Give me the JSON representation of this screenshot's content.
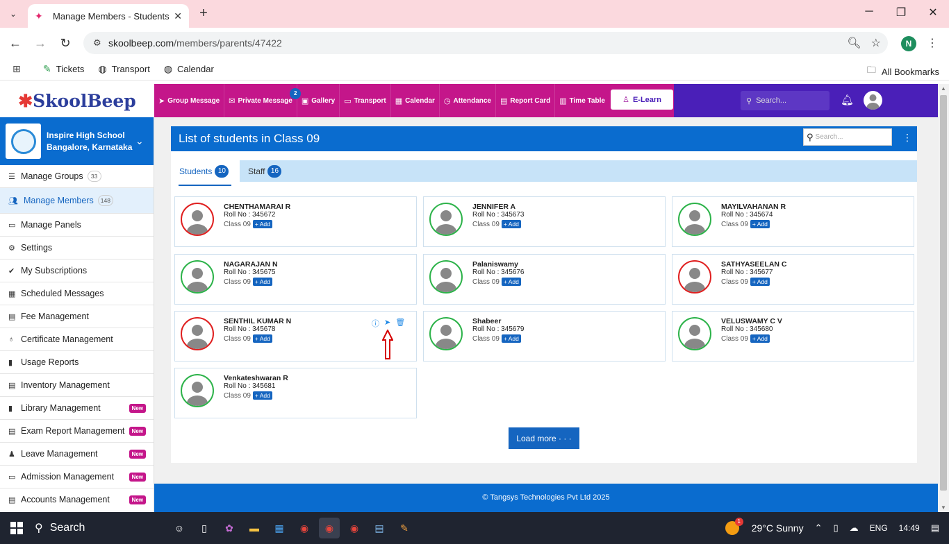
{
  "browser": {
    "tab_title": "Manage Members - Students",
    "url_domain": "skoolbeep.com",
    "url_path": "/members/parents/47422",
    "profile_initial": "N",
    "bookmarks": [
      "Tickets",
      "Transport",
      "Calendar"
    ],
    "all_bookmarks": "All Bookmarks"
  },
  "header": {
    "logo": "SkoolBeep",
    "menu": [
      {
        "label": "Group Message",
        "icon": "send-icon"
      },
      {
        "label": "Private Message",
        "icon": "mail-icon",
        "badge": "2"
      },
      {
        "label": "Gallery",
        "icon": "image-icon"
      },
      {
        "label": "Transport",
        "icon": "bus-icon"
      },
      {
        "label": "Calendar",
        "icon": "calendar-icon"
      },
      {
        "label": "Attendance",
        "icon": "clock-icon"
      },
      {
        "label": "Report Card",
        "icon": "document-icon"
      },
      {
        "label": "Time Table",
        "icon": "table-icon"
      }
    ],
    "elearn": "E-Learn",
    "search_placeholder": "Search..."
  },
  "sidebar": {
    "school_name": "Inspire High School",
    "school_location": "Bangalore, Karnataka",
    "items": [
      {
        "label": "Manage Groups",
        "count": "33"
      },
      {
        "label": "Manage Members",
        "count": "148",
        "active": true
      },
      {
        "label": "Manage Panels"
      },
      {
        "label": "Settings"
      },
      {
        "label": "My Subscriptions"
      },
      {
        "label": "Scheduled Messages"
      },
      {
        "label": "Fee Management"
      },
      {
        "label": "Certificate Management"
      },
      {
        "label": "Usage Reports"
      },
      {
        "label": "Inventory Management"
      },
      {
        "label": "Library Management",
        "badge": "New"
      },
      {
        "label": "Exam Report Management",
        "badge": "New"
      },
      {
        "label": "Leave Management",
        "badge": "New"
      },
      {
        "label": "Admission Management",
        "badge": "New"
      },
      {
        "label": "Accounts Management",
        "badge": "New"
      }
    ]
  },
  "main": {
    "title": "List of students in Class 09",
    "search_placeholder": "Search...",
    "tabs": [
      {
        "label": "Students",
        "count": "10"
      },
      {
        "label": "Staff",
        "count": "16"
      }
    ],
    "students": [
      {
        "name": "CHENTHAMARAI R",
        "roll": "Roll No : 345672",
        "class": "Class 09",
        "status": "red"
      },
      {
        "name": "JENNIFER A",
        "roll": "Roll No : 345673",
        "class": "Class 09",
        "status": "green"
      },
      {
        "name": "MAYILVAHANAN R",
        "roll": "Roll No : 345674",
        "class": "Class 09",
        "status": "green"
      },
      {
        "name": "NAGARAJAN N",
        "roll": "Roll No : 345675",
        "class": "Class 09",
        "status": "green"
      },
      {
        "name": "Palaniswamy",
        "roll": "Roll No : 345676",
        "class": "Class 09",
        "status": "green"
      },
      {
        "name": "SATHYASEELAN C",
        "roll": "Roll No : 345677",
        "class": "Class 09",
        "status": "red"
      },
      {
        "name": "SENTHIL KUMAR N",
        "roll": "Roll No : 345678",
        "class": "Class 09",
        "status": "red"
      },
      {
        "name": "Shabeer",
        "roll": "Roll No : 345679",
        "class": "Class 09",
        "status": "green"
      },
      {
        "name": "VELUSWAMY C V",
        "roll": "Roll No : 345680",
        "class": "Class 09",
        "status": "green"
      },
      {
        "name": "Venkateshwaran R",
        "roll": "Roll No : 345681",
        "class": "Class 09",
        "status": "green"
      }
    ],
    "add_label": "+ Add",
    "load_more": "Load more · · ·",
    "footer": "© Tangsys Technologies Pvt Ltd 2025"
  },
  "taskbar": {
    "search": "Search",
    "weather": "29°C  Sunny",
    "weather_badge": "1",
    "lang": "ENG",
    "time": "14:49"
  }
}
